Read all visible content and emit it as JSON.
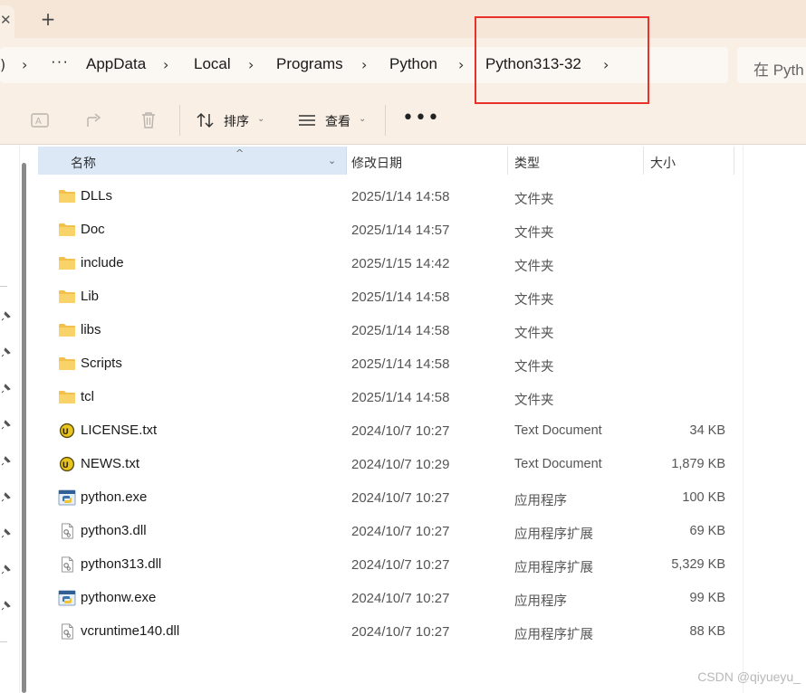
{
  "tabs": {
    "new_tab_glyph": "+"
  },
  "breadcrumb": {
    "items": [
      {
        "label": "AppData"
      },
      {
        "label": "Local"
      },
      {
        "label": "Programs"
      },
      {
        "label": "Python"
      },
      {
        "label": "Python313-32"
      }
    ],
    "ellipsis": "···"
  },
  "search": {
    "placeholder": "在 Pyth"
  },
  "toolbar": {
    "sort_label": "排序",
    "view_label": "查看",
    "more_label": "•••"
  },
  "columns": {
    "name": "名称",
    "date": "修改日期",
    "type": "类型",
    "size": "大小"
  },
  "files": [
    {
      "name": "DLLs",
      "date": "2025/1/14 14:58",
      "type": "文件夹",
      "size": "",
      "icon": "folder-icon"
    },
    {
      "name": "Doc",
      "date": "2025/1/14 14:57",
      "type": "文件夹",
      "size": "",
      "icon": "folder-icon"
    },
    {
      "name": "include",
      "date": "2025/1/15 14:42",
      "type": "文件夹",
      "size": "",
      "icon": "folder-icon"
    },
    {
      "name": "Lib",
      "date": "2025/1/14 14:58",
      "type": "文件夹",
      "size": "",
      "icon": "folder-icon"
    },
    {
      "name": "libs",
      "date": "2025/1/14 14:58",
      "type": "文件夹",
      "size": "",
      "icon": "folder-icon"
    },
    {
      "name": "Scripts",
      "date": "2025/1/14 14:58",
      "type": "文件夹",
      "size": "",
      "icon": "folder-icon"
    },
    {
      "name": "tcl",
      "date": "2025/1/14 14:58",
      "type": "文件夹",
      "size": "",
      "icon": "folder-icon"
    },
    {
      "name": "LICENSE.txt",
      "date": "2024/10/7 10:27",
      "type": "Text Document",
      "size": "34 KB",
      "icon": "text-document-icon"
    },
    {
      "name": "NEWS.txt",
      "date": "2024/10/7 10:29",
      "type": "Text Document",
      "size": "1,879 KB",
      "icon": "text-document-icon"
    },
    {
      "name": "python.exe",
      "date": "2024/10/7 10:27",
      "type": "应用程序",
      "size": "100 KB",
      "icon": "python-exe-icon"
    },
    {
      "name": "python3.dll",
      "date": "2024/10/7 10:27",
      "type": "应用程序扩展",
      "size": "69 KB",
      "icon": "dll-file-icon"
    },
    {
      "name": "python313.dll",
      "date": "2024/10/7 10:27",
      "type": "应用程序扩展",
      "size": "5,329 KB",
      "icon": "dll-file-icon"
    },
    {
      "name": "pythonw.exe",
      "date": "2024/10/7 10:27",
      "type": "应用程序",
      "size": "99 KB",
      "icon": "python-exe-icon"
    },
    {
      "name": "vcruntime140.dll",
      "date": "2024/10/7 10:27",
      "type": "应用程序扩展",
      "size": "88 KB",
      "icon": "dll-file-icon"
    }
  ],
  "watermark": "CSDN @qiyueyu_",
  "colors": {
    "accent_highlight": "#e8312a",
    "folder": "#f3c14b",
    "header_selected": "#dce8f6",
    "chrome": "#f9efe5"
  }
}
